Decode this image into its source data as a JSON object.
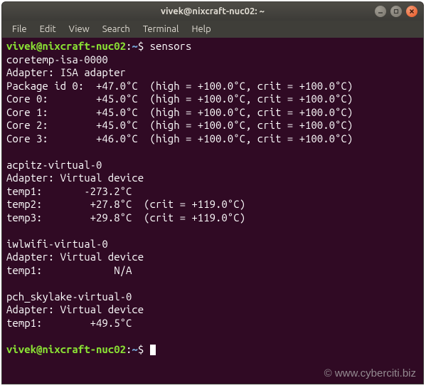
{
  "window": {
    "title": "vivek@nixcraft-nuc02: ~"
  },
  "menu": {
    "file": "File",
    "edit": "Edit",
    "view": "View",
    "search": "Search",
    "terminal": "Terminal",
    "help": "Help"
  },
  "prompt": {
    "userhost": "vivek@nixcraft-nuc02",
    "sep1": ":",
    "path": "~",
    "sep2": "$ "
  },
  "command": "sensors",
  "output": {
    "l01": "coretemp-isa-0000",
    "l02": "Adapter: ISA adapter",
    "l03": "Package id 0:  +47.0°C  (high = +100.0°C, crit = +100.0°C)",
    "l04": "Core 0:        +45.0°C  (high = +100.0°C, crit = +100.0°C)",
    "l05": "Core 1:        +45.0°C  (high = +100.0°C, crit = +100.0°C)",
    "l06": "Core 2:        +45.0°C  (high = +100.0°C, crit = +100.0°C)",
    "l07": "Core 3:        +46.0°C  (high = +100.0°C, crit = +100.0°C)",
    "l08": "",
    "l09": "acpitz-virtual-0",
    "l10": "Adapter: Virtual device",
    "l11": "temp1:       -273.2°C",
    "l12": "temp2:        +27.8°C  (crit = +119.0°C)",
    "l13": "temp3:        +29.8°C  (crit = +119.0°C)",
    "l14": "",
    "l15": "iwlwifi-virtual-0",
    "l16": "Adapter: Virtual device",
    "l17": "temp1:            N/A",
    "l18": "",
    "l19": "pch_skylake-virtual-0",
    "l20": "Adapter: Virtual device",
    "l21": "temp1:        +49.5°C",
    "l22": ""
  },
  "watermark": "© www.cyberciti.biz"
}
